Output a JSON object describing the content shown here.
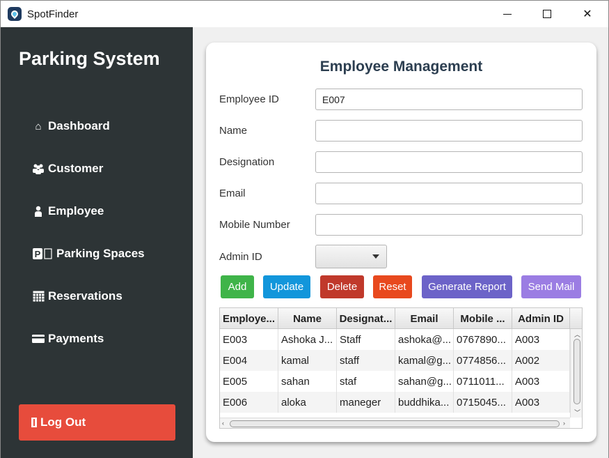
{
  "window": {
    "title": "SpotFinder"
  },
  "sidebar": {
    "title": "Parking System",
    "items": [
      {
        "label": "Dashboard",
        "icon": "⌂"
      },
      {
        "label": "Customer",
        "icon": "👥"
      },
      {
        "label": "Employee",
        "icon": "👤"
      },
      {
        "label": "Parking Spaces",
        "icon": "🅿"
      },
      {
        "label": "Reservations",
        "icon": "▦"
      },
      {
        "label": "Payments",
        "icon": "▬"
      }
    ],
    "logout": {
      "label": "Log Out",
      "icon": "▮"
    }
  },
  "form": {
    "title": "Employee Management",
    "fields": {
      "employee_id": {
        "label": "Employee ID",
        "value": "E007"
      },
      "name": {
        "label": "Name",
        "value": ""
      },
      "designation": {
        "label": "Designation",
        "value": ""
      },
      "email": {
        "label": "Email",
        "value": ""
      },
      "mobile": {
        "label": "Mobile Number",
        "value": ""
      },
      "admin_id": {
        "label": "Admin ID",
        "value": ""
      }
    },
    "buttons": {
      "add": "Add",
      "update": "Update",
      "delete": "Delete",
      "reset": "Reset",
      "report": "Generate Report",
      "mail": "Send Mail"
    }
  },
  "table": {
    "columns": [
      "Employe...",
      "Name",
      "Designat...",
      "Email",
      "Mobile ...",
      "Admin ID"
    ],
    "rows": [
      [
        "E003",
        "Ashoka J...",
        "Staff",
        "ashoka@...",
        "0767890...",
        "A003"
      ],
      [
        "E004",
        "kamal",
        "staff",
        "kamal@g...",
        "0774856...",
        "A002"
      ],
      [
        "E005",
        "sahan",
        "staf",
        "sahan@g...",
        "0711011...",
        "A003"
      ],
      [
        "E006",
        "aloka",
        "maneger",
        "buddhika...",
        "0715045...",
        "A003"
      ]
    ]
  },
  "colors": {
    "sidebar": "#2d3436",
    "logout": "#e74c3c",
    "add": "#3fb449",
    "update": "#1296db",
    "delete": "#c0392b",
    "reset": "#e8491e",
    "report": "#6c63c8",
    "mail": "#9b7de3"
  }
}
